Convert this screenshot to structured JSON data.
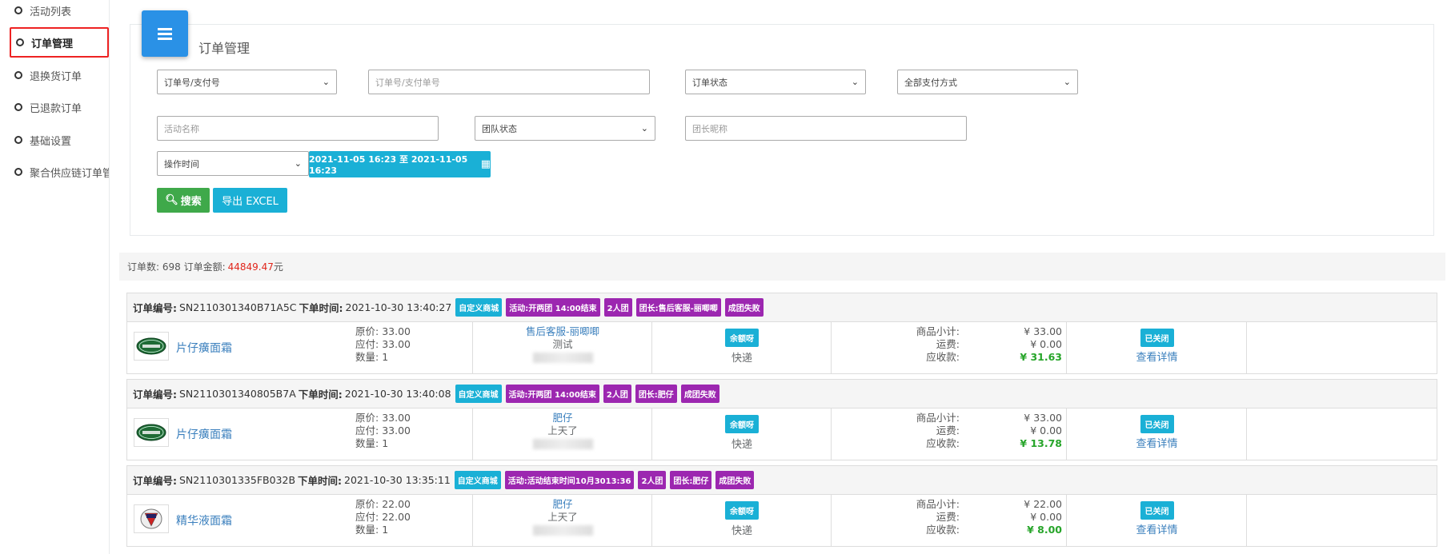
{
  "sidebar": {
    "items": [
      {
        "label": "活动列表"
      },
      {
        "label": "订单管理"
      },
      {
        "label": "退换货订单"
      },
      {
        "label": "已退款订单"
      },
      {
        "label": "基础设置"
      },
      {
        "label": "聚合供应链订单管"
      }
    ]
  },
  "filter": {
    "title": "订单管理",
    "order_no_select": "订单号/支付号",
    "order_no_placeholder": "订单号/支付单号",
    "order_status_select": "订单状态",
    "pay_method_select": "全部支付方式",
    "activity_placeholder": "活动名称",
    "team_status_select": "团队状态",
    "leader_placeholder": "团长昵称",
    "time_select": "操作时间",
    "date_range": "2021-11-05 16:23 至 2021-11-05 16:23",
    "search_label": "搜索",
    "export_label": "导出 EXCEL"
  },
  "summary": {
    "prefix": "订单数: 698 订单金额:",
    "amount": "44849.47",
    "suffix": "元"
  },
  "labels": {
    "order_no": "订单编号:",
    "order_time": "下单时间:",
    "orig_price": "原价:",
    "payable": "应付:",
    "qty": "数量:",
    "subtotal": "商品小计:",
    "shipping": "运费:",
    "receivable": "应收款:",
    "view_detail": "查看详情"
  },
  "orders": [
    {
      "no": "SN2110301340B71A5C",
      "time": "2021-10-30 13:40:27",
      "tags": [
        {
          "text": "自定义商城",
          "kind": "c"
        },
        {
          "text": "活动:开两团 14:00结束",
          "kind": "p"
        },
        {
          "text": "2人团",
          "kind": "p"
        },
        {
          "text": "团长:售后客服-丽唧唧",
          "kind": "p"
        },
        {
          "text": "成团失败",
          "kind": "p"
        }
      ],
      "product": "片仔癀面霜",
      "logo": "land-rover-logo",
      "orig_price": "33.00",
      "payable": "33.00",
      "qty": "1",
      "seller_name": "售后客服-丽唧唧",
      "seller_note": "测试",
      "pay_tag": "余额呀",
      "delivery": "快递",
      "subtotal": "¥ 33.00",
      "shipping": "¥ 0.00",
      "receivable": "¥ 31.63",
      "status": "已关闭"
    },
    {
      "no": "SN2110301340805B7A",
      "time": "2021-10-30 13:40:08",
      "tags": [
        {
          "text": "自定义商城",
          "kind": "c"
        },
        {
          "text": "活动:开两团 14:00结束",
          "kind": "p"
        },
        {
          "text": "2人团",
          "kind": "p"
        },
        {
          "text": "团长:肥仔",
          "kind": "p"
        },
        {
          "text": "成团失败",
          "kind": "p"
        }
      ],
      "product": "片仔癀面霜",
      "logo": "land-rover-logo",
      "orig_price": "33.00",
      "payable": "33.00",
      "qty": "1",
      "seller_name": "肥仔",
      "seller_note": "上天了",
      "pay_tag": "余额呀",
      "delivery": "快递",
      "subtotal": "¥ 33.00",
      "shipping": "¥ 0.00",
      "receivable": "¥ 13.78",
      "status": "已关闭"
    },
    {
      "no": "SN2110301335FB032B",
      "time": "2021-10-30 13:35:11",
      "tags": [
        {
          "text": "自定义商城",
          "kind": "c"
        },
        {
          "text": "活动:活动结束时间10月3013:36",
          "kind": "p"
        },
        {
          "text": "2人团",
          "kind": "p"
        },
        {
          "text": "团长:肥仔",
          "kind": "p"
        },
        {
          "text": "成团失败",
          "kind": "p"
        }
      ],
      "product": "精华液面霜",
      "logo": "cadillac-logo",
      "orig_price": "22.00",
      "payable": "22.00",
      "qty": "1",
      "seller_name": "肥仔",
      "seller_note": "上天了",
      "pay_tag": "余额呀",
      "delivery": "快递",
      "subtotal": "¥ 22.00",
      "shipping": "¥ 0.00",
      "receivable": "¥ 8.00",
      "status": "已关闭"
    }
  ]
}
